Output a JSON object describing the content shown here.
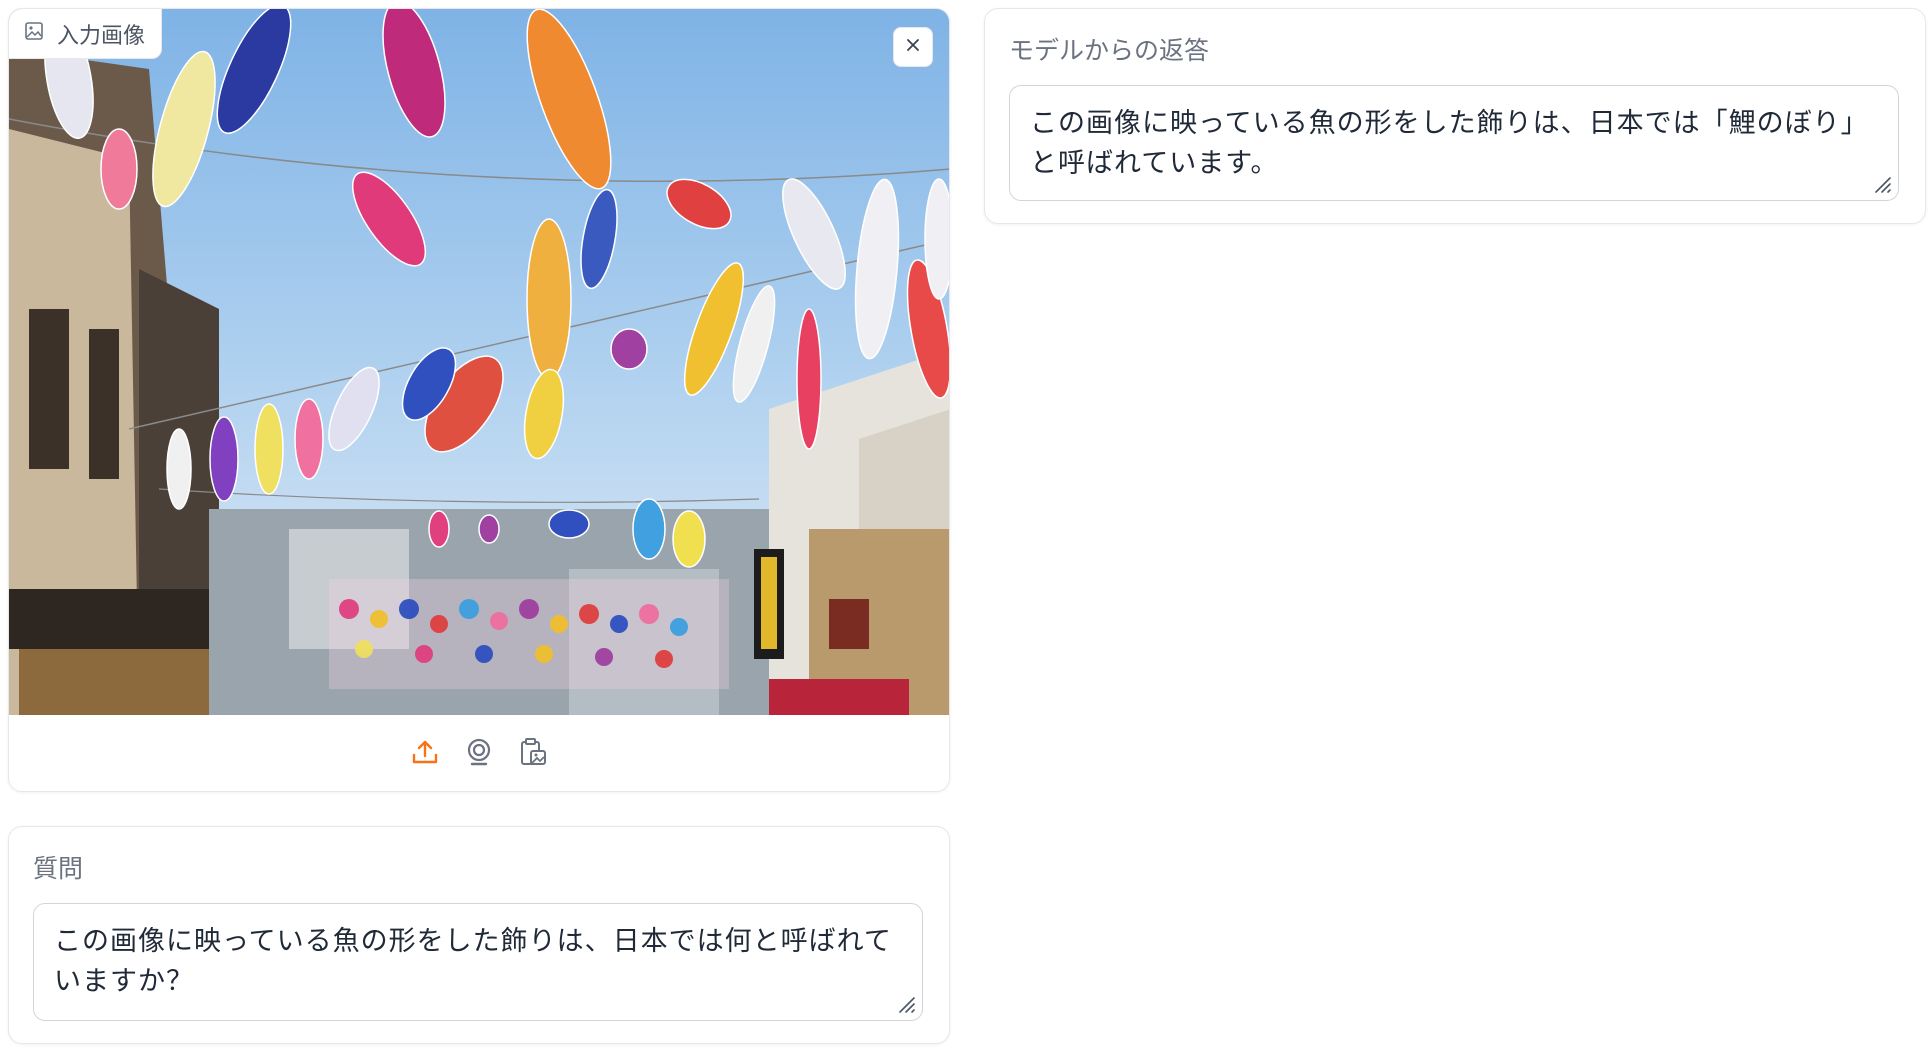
{
  "image_input": {
    "label": "入力画像",
    "icons": {
      "label_icon": "image-icon",
      "close": "close-icon",
      "upload": "upload-icon",
      "webcam": "webcam-icon",
      "clipboard": "clipboard-icon"
    },
    "accent_color": "#f97316"
  },
  "question": {
    "label": "質問",
    "value": "この画像に映っている魚の形をした飾りは、日本では何と呼ばれていますか？"
  },
  "answer": {
    "label": "モデルからの返答",
    "value": "この画像に映っている魚の形をした飾りは、日本では「鯉のぼり」と呼ばれています。"
  }
}
